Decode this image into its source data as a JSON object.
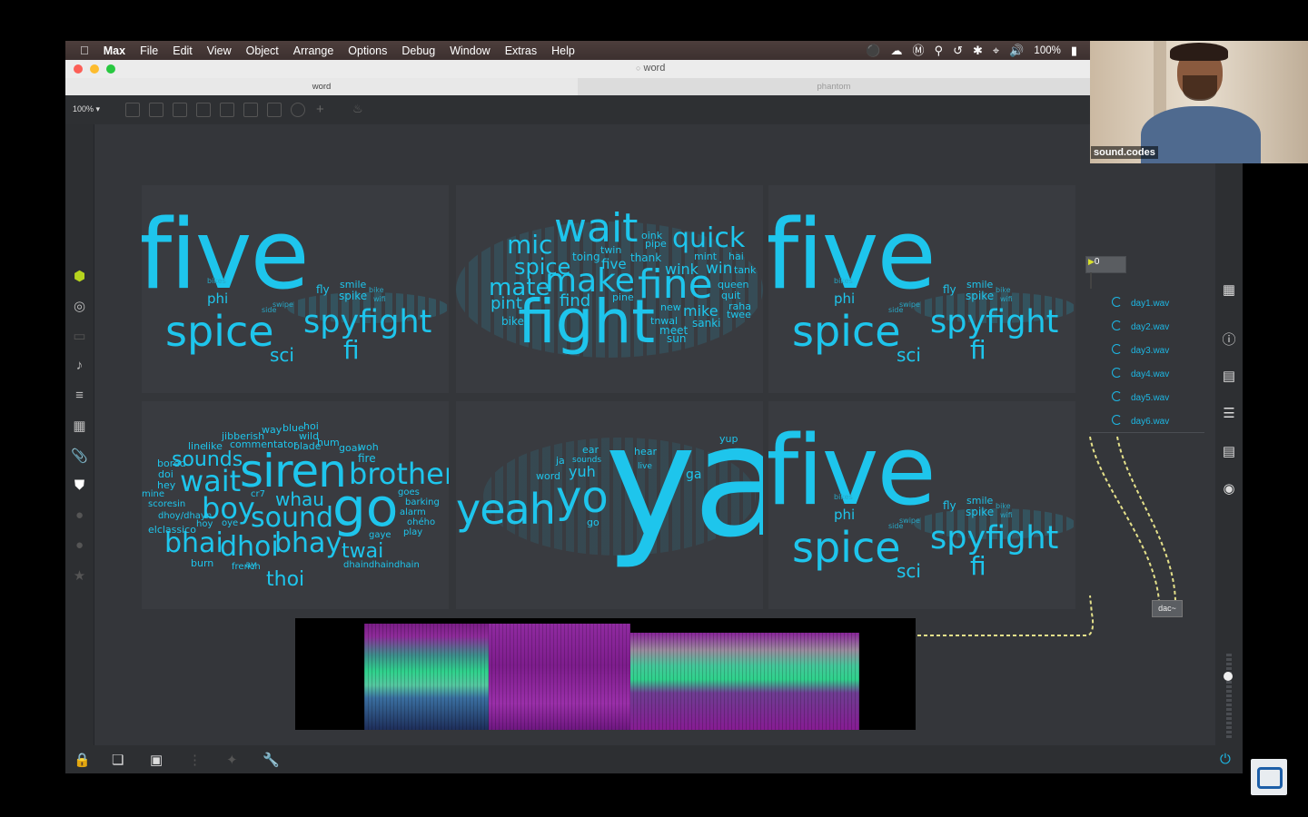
{
  "menubar": {
    "apple": "",
    "app": "Max",
    "items": [
      "File",
      "Edit",
      "View",
      "Object",
      "Arrange",
      "Options",
      "Debug",
      "Window",
      "Extras",
      "Help"
    ],
    "battery_text": "100%",
    "icons": [
      "do-not-disturb-icon",
      "creative-cloud-icon",
      "m-icon",
      "search-icon",
      "time-machine-icon",
      "bluetooth-icon",
      "wifi-icon",
      "volume-icon",
      "battery-icon"
    ]
  },
  "window": {
    "title": "word"
  },
  "tabs": [
    {
      "label": "word"
    },
    {
      "label": "phantom"
    }
  ],
  "toolbar": {
    "zoom": "100% ▾"
  },
  "wordclouds": [
    {
      "big": "five",
      "words": [
        "spice",
        "spyfight",
        "sci",
        "fi",
        "phi",
        "fly",
        "smile",
        "spike",
        "bike",
        "wifi",
        "bikes",
        "swipe",
        "side"
      ]
    },
    {
      "big": "wait",
      "words": [
        "mic",
        "quick",
        "spice",
        "make",
        "fine",
        "mate",
        "fight",
        "pint",
        "find",
        "bike",
        "five",
        "toing",
        "thank",
        "wink",
        "win",
        "tank",
        "quit",
        "queen",
        "raha",
        "twee",
        "mike",
        "sanki",
        "meet",
        "sun",
        "twin",
        "oink",
        "pipe",
        "mint",
        "hai",
        "pine",
        "new",
        "tnwal"
      ]
    },
    {
      "big": "five",
      "words": [
        "spice",
        "spyfight",
        "sci",
        "fi",
        "phi",
        "fly",
        "smile",
        "spike",
        "bike",
        "wifi",
        "bikes",
        "swipe",
        "side"
      ]
    },
    {
      "big": "siren",
      "words": [
        "sounds",
        "wait",
        "brother",
        "go",
        "boy",
        "sound",
        "whau",
        "bhai",
        "dhoi",
        "bhay",
        "twai",
        "thoi",
        "jibberish",
        "way",
        "blue",
        "hoi",
        "wild",
        "line",
        "like",
        "commentator",
        "blade",
        "hum",
        "goal",
        "woh",
        "fire",
        "bored",
        "doi",
        "hey",
        "mine",
        "scoresin",
        "dhoy/dhayn",
        "elclassico",
        "hoy",
        "oye",
        "cr7",
        "goes",
        "barking",
        "alarm",
        "ohého",
        "play",
        "gaye",
        "burn",
        "french",
        "ay",
        "dhaindhaindhain",
        "duh"
      ]
    },
    {
      "big": "ya",
      "words": [
        "yeah",
        "yo",
        "yup",
        "hear",
        "ear",
        "ja",
        "sounds",
        "yuh",
        "word",
        "ga",
        "live",
        "go"
      ]
    },
    {
      "big": "five",
      "words": [
        "spice",
        "spyfight",
        "sci",
        "fi",
        "phi",
        "fly",
        "smile",
        "spike",
        "bike",
        "wifi",
        "bikes",
        "swipe",
        "side"
      ]
    }
  ],
  "patch": {
    "number_box": "0",
    "files": [
      "day1.wav",
      "day2.wav",
      "day3.wav",
      "day4.wav",
      "day5.wav",
      "day6.wav"
    ],
    "dac": "dac~"
  },
  "webcam": {
    "label": "sound.codes"
  },
  "colors": {
    "cloud": "#1ec5ec",
    "file": "#1db7e4",
    "patch_cord": "#e4e08a"
  }
}
